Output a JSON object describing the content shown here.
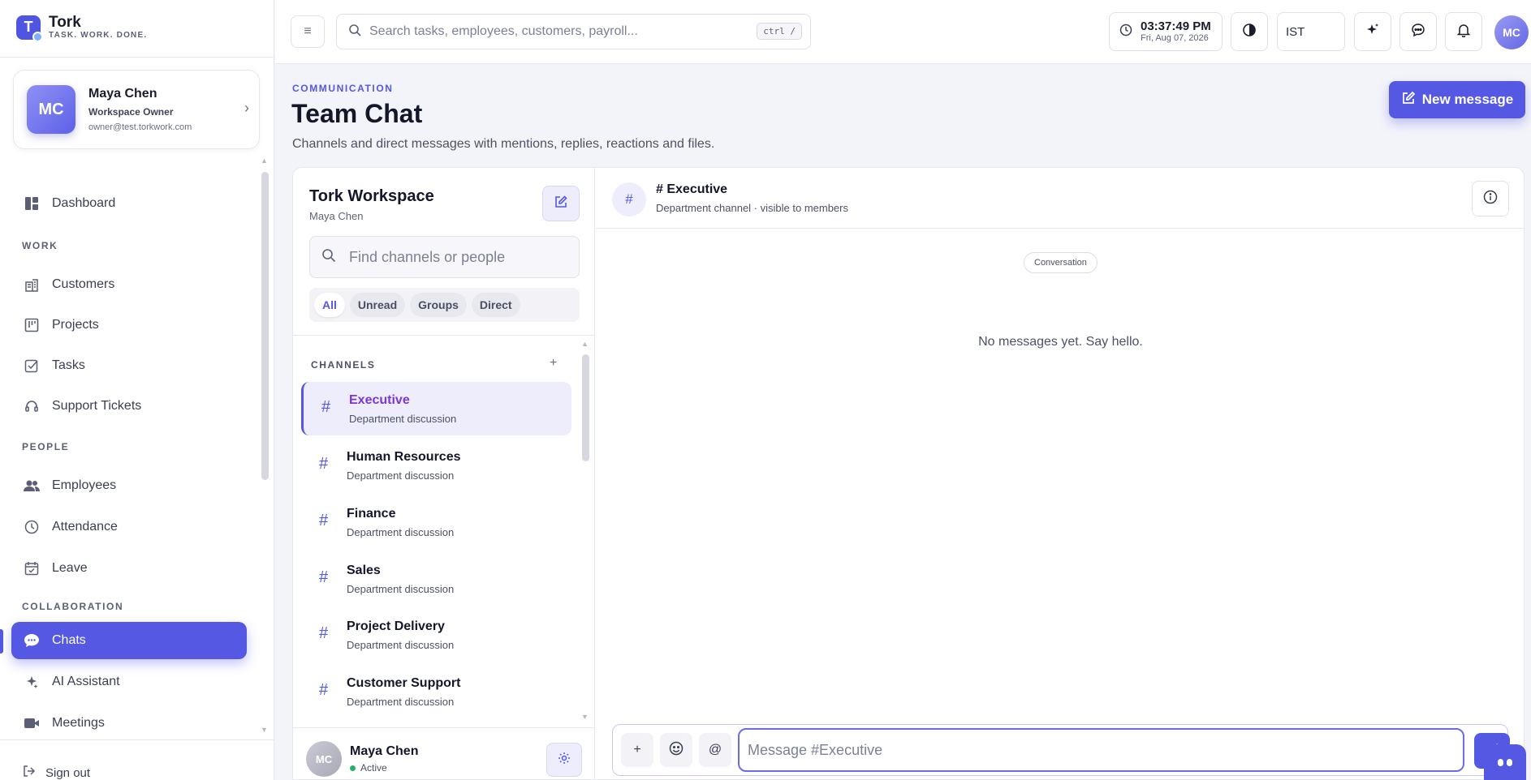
{
  "brand": {
    "name": "Tork",
    "tagline": "TASK. WORK. DONE.",
    "logo_letter": "T"
  },
  "profile": {
    "initials": "MC",
    "name": "Maya Chen",
    "role": "Workspace Owner",
    "email": "owner@test.torkwork.com"
  },
  "nav": {
    "dashboard": "Dashboard",
    "sections": {
      "work": "WORK",
      "people": "PEOPLE",
      "collaboration": "COLLABORATION"
    },
    "customers": "Customers",
    "projects": "Projects",
    "tasks": "Tasks",
    "support_tickets": "Support Tickets",
    "employees": "Employees",
    "attendance": "Attendance",
    "leave": "Leave",
    "chats": "Chats",
    "ai_assistant": "AI Assistant",
    "meetings": "Meetings",
    "sign_out": "Sign out"
  },
  "topbar": {
    "search_placeholder": "Search tasks, employees, customers, payroll...",
    "search_shortcut": "ctrl /",
    "time": "03:37:49 PM",
    "date": "Fri, Aug 07, 2026",
    "timezone": "IST",
    "avatar_initials": "MC"
  },
  "page": {
    "eyebrow": "COMMUNICATION",
    "title": "Team Chat",
    "subtitle": "Channels and direct messages with mentions, replies, reactions and files.",
    "new_message": "New message"
  },
  "workspace": {
    "name": "Tork Workspace",
    "user": "Maya Chen",
    "find_placeholder": "Find channels or people"
  },
  "filters": [
    "All",
    "Unread",
    "Groups",
    "Direct"
  ],
  "channels_heading": "CHANNELS",
  "channels": [
    {
      "name": "Executive",
      "desc": "Department discussion"
    },
    {
      "name": "Human Resources",
      "desc": "Department discussion"
    },
    {
      "name": "Finance",
      "desc": "Department discussion"
    },
    {
      "name": "Sales",
      "desc": "Department discussion"
    },
    {
      "name": "Project Delivery",
      "desc": "Department discussion"
    },
    {
      "name": "Customer Support",
      "desc": "Department discussion"
    }
  ],
  "me": {
    "initials": "MC",
    "name": "Maya Chen",
    "status": "Active"
  },
  "conversation": {
    "title": "# Executive",
    "subtitle": "Department channel · visible to members",
    "divider": "Conversation",
    "empty": "No messages yet. Say hello.",
    "composer_placeholder": "Message #Executive",
    "mention_symbol": "@"
  },
  "colors": {
    "accent": "#5558e3",
    "active_channel_text": "#7b36d6",
    "status_online": "#23b26d"
  }
}
